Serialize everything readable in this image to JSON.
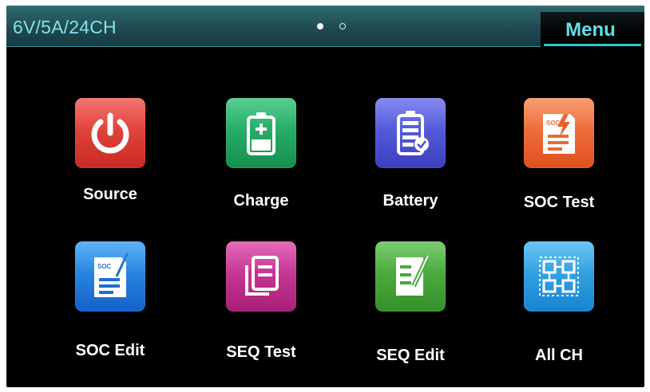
{
  "header": {
    "model": "6V/5A/24CH",
    "menu_label": "Menu"
  },
  "apps": [
    {
      "label": "Source",
      "icon": "power-icon",
      "color": "#e53b35"
    },
    {
      "label": "Charge",
      "icon": "battery-charge-icon",
      "color": "#1fae63"
    },
    {
      "label": "Battery",
      "icon": "battery-check-icon",
      "color": "#4b52d8"
    },
    {
      "label": "SOC Test",
      "icon": "soc-test-icon",
      "color": "#ef6a2e"
    },
    {
      "label": "SOC Edit",
      "icon": "soc-edit-icon",
      "color": "#1f86e6"
    },
    {
      "label": "SEQ Test",
      "icon": "seq-test-icon",
      "color": "#c22d8f"
    },
    {
      "label": "SEQ Edit",
      "icon": "seq-edit-icon",
      "color": "#46a83a"
    },
    {
      "label": "All CH",
      "icon": "all-channels-icon",
      "color": "#2aa0e6"
    }
  ]
}
